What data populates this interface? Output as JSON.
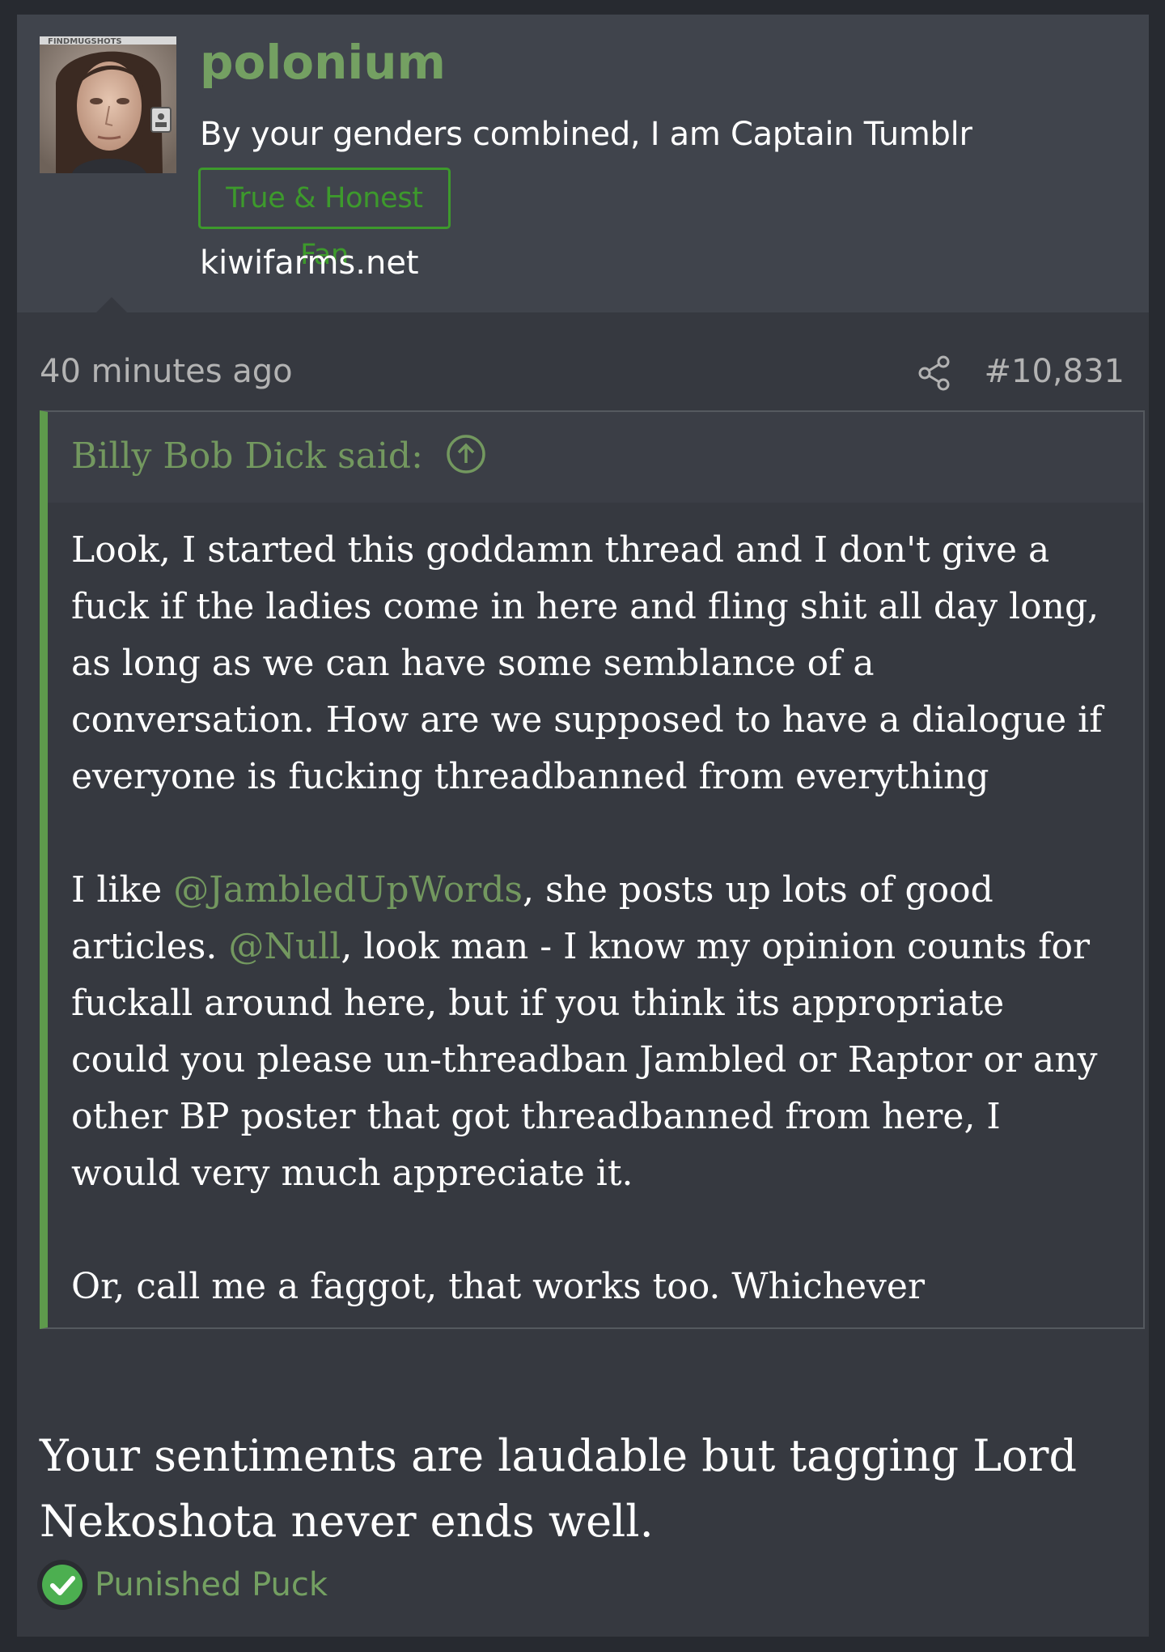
{
  "user": {
    "name": "polonium",
    "title": "By your genders combined, I am Captain Tumblr",
    "banner": "True & Honest Fan",
    "site": "kiwifarms.net",
    "avatar_watermark": "FINDMUGSHOTS"
  },
  "post": {
    "time": "40 minutes ago",
    "number": "#10,831"
  },
  "quote": {
    "author_label": "Billy Bob Dick said:",
    "p1": [
      "Look, I started this goddamn thread and I don't give a",
      "fuck if the ladies come in here and fling shit all day long,",
      "as long as we can have some semblance of a",
      "conversation. How are we supposed to have a dialogue if",
      "everyone is fucking threadbanned from everything"
    ],
    "p2": {
      "l1_before": "I like ",
      "mention1": "@JambledUpWords",
      "l1_after": ", she posts up lots of good",
      "l2_before": "articles. ",
      "mention2": "@Null",
      "l2_after": ", look man - I know my opinion counts for",
      "l3": "fuckall around here, but if you think its appropriate",
      "l4": "could you please un-threadban Jambled or Raptor or any",
      "l5": "other BP poster that got threadbanned from here, I",
      "l6": "would very much appreciate it."
    },
    "p3": "Or, call me a faggot, that works too. Whichever"
  },
  "reply": {
    "lines": [
      "Your sentiments are laudable but tagging Lord",
      "Nekoshota never ends well."
    ]
  },
  "reactions": {
    "user": "Punished Puck",
    "icon": "checkmark-icon"
  },
  "colors": {
    "page_bg": "#272a30",
    "card_bg": "#363940",
    "header_bg": "#40444c",
    "username": "#74a062",
    "banner": "#3d9a2c",
    "quote_bar": "#5e9a4c",
    "meta_text": "#b3b3b3"
  }
}
